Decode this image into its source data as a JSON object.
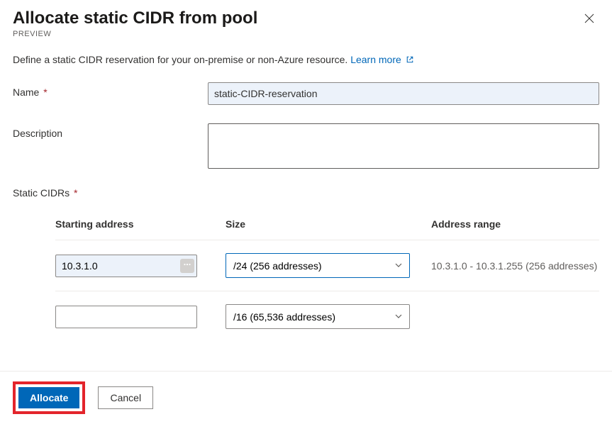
{
  "header": {
    "title": "Allocate static CIDR from pool",
    "badge": "PREVIEW"
  },
  "intro": {
    "text": "Define a static CIDR reservation for your on-premise or non-Azure resource. ",
    "learn_more": "Learn more"
  },
  "fields": {
    "name": {
      "label": "Name",
      "value": "static-CIDR-reservation"
    },
    "description": {
      "label": "Description",
      "value": ""
    },
    "static_cidrs": {
      "label": "Static CIDRs"
    }
  },
  "table": {
    "columns": {
      "starting_address": "Starting address",
      "size": "Size",
      "address_range": "Address range"
    },
    "rows": [
      {
        "starting_address": "10.3.1.0",
        "size": "/24 (256 addresses)",
        "range": "10.3.1.0 - 10.3.1.255 (256 addresses)"
      },
      {
        "starting_address": "",
        "size": "/16 (65,536 addresses)",
        "range": ""
      }
    ]
  },
  "footer": {
    "allocate": "Allocate",
    "cancel": "Cancel"
  }
}
